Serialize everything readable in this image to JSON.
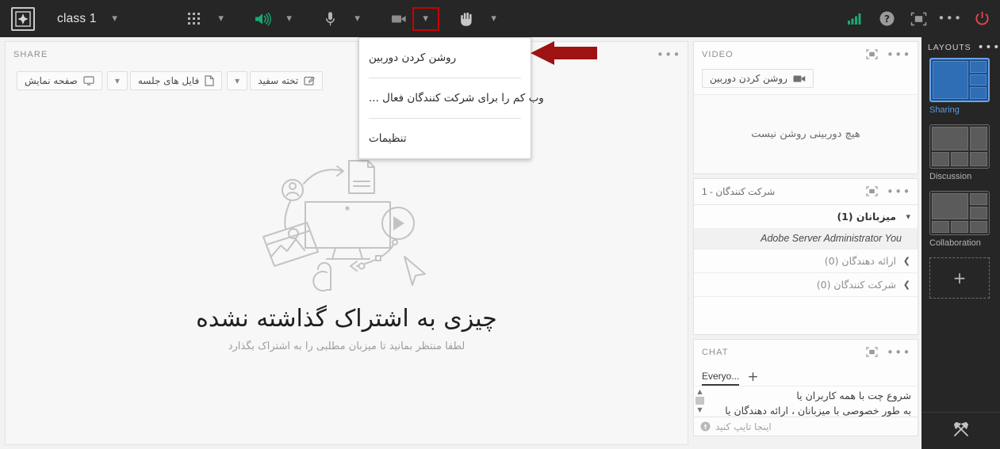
{
  "topbar": {
    "logo_icon": "adobe-connect-logo-icon",
    "room_title": "class 1",
    "room_title_chevron": "chevron-down-icon",
    "tools": [
      {
        "name": "apps-grid",
        "icon": "apps-grid-icon",
        "chevron": "chevron-down-icon",
        "highlighted": false
      },
      {
        "name": "speaker",
        "icon": "speaker-on-icon",
        "chevron": "chevron-down-icon",
        "highlighted": false
      },
      {
        "name": "microphone",
        "icon": "microphone-icon",
        "chevron": "chevron-down-icon",
        "highlighted": false
      },
      {
        "name": "camera",
        "icon": "video-camera-icon",
        "chevron": "chevron-down-icon",
        "highlighted": true
      },
      {
        "name": "raise-hand",
        "icon": "raised-hand-icon",
        "chevron": "chevron-down-icon",
        "highlighted": false
      }
    ],
    "right_icons": [
      {
        "name": "connection-status",
        "icon": "signal-bars-icon"
      },
      {
        "name": "help",
        "icon": "question-mark-circle-icon"
      },
      {
        "name": "fullscreen",
        "icon": "fullscreen-icon"
      },
      {
        "name": "more-options",
        "icon": "ellipsis-icon"
      },
      {
        "name": "end-session",
        "icon": "power-icon"
      }
    ],
    "highlight_color": "#cc0000",
    "accent_green": "#19a974",
    "background": "#262626"
  },
  "camera_dropdown": {
    "items": [
      {
        "label": "روشن کردن دوربین"
      },
      {
        "label": "وب کم را برای شرکت کنندگان فعال ..."
      },
      {
        "label": "تنظیمات"
      }
    ],
    "annotation_arrow_color": "#9e1212"
  },
  "share_pod": {
    "title": "SHARE",
    "menu_icon": "ellipsis-icon",
    "buttons": [
      {
        "label": "صفحه نمایش",
        "icon": "monitor-icon",
        "has_chevron": false
      },
      {
        "label": "فایل های جلسه",
        "icon": "document-icon",
        "has_chevron": true
      },
      {
        "label": "تخته سفید",
        "icon": "whiteboard-icon",
        "has_chevron": true
      }
    ],
    "empty_headline": "چیزی به اشتراک گذاشته نشده",
    "empty_subtitle": "لطفا منتظر بمانید تا میزبان مطلبی را به اشتراک بگذارد",
    "illustration_name": "share-content-illustration"
  },
  "video_pod": {
    "title": "VIDEO",
    "fullscreen_icon": "fullscreen-icon",
    "menu_icon": "ellipsis-icon",
    "start_camera_label": "روشن کردن دوربین",
    "start_camera_icon": "video-camera-icon",
    "empty_text": "هیچ دوربینی روشن نیست"
  },
  "participants_pod": {
    "title": "شرکت کنندگان - 1",
    "fullscreen_icon": "fullscreen-icon",
    "menu_icon": "ellipsis-icon",
    "groups": [
      {
        "label": "میزبانان (1)",
        "expanded": true,
        "caret": "chevron-down-icon",
        "members": [
          "Adobe Server Administrator  You"
        ]
      },
      {
        "label": "ارائه دهندگان (0)",
        "expanded": false,
        "caret": "chevron-left-icon",
        "members": []
      },
      {
        "label": "شرکت کنندگان (0)",
        "expanded": false,
        "caret": "chevron-left-icon",
        "members": []
      }
    ]
  },
  "chat_pod": {
    "title": "CHAT",
    "fullscreen_icon": "fullscreen-icon",
    "menu_icon": "ellipsis-icon",
    "tab_label": "Everyo...",
    "add_tab_label": "+",
    "message_line_1": "شروع چت با همه کاربران یا",
    "message_line_2": "به طور خصوصی با میزبانان ، ارائه دهندگان یا",
    "input_placeholder": "اینجا تایپ کنید",
    "input_icon": "info-circle-icon"
  },
  "layouts": {
    "title": "LAYOUTS",
    "menu_icon": "ellipsis-icon",
    "items": [
      {
        "label": "Sharing",
        "active": true
      },
      {
        "label": "Discussion",
        "active": false
      },
      {
        "label": "Collaboration",
        "active": false
      }
    ],
    "add_layout_label": "+",
    "tools_icon": "hammer-wrench-icon",
    "active_color": "#5a9bdc"
  }
}
